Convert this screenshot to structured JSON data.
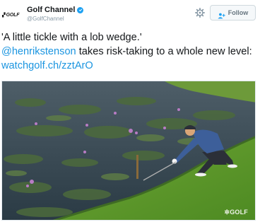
{
  "account": {
    "avatar_text": "GOLF",
    "display_name": "Golf Channel",
    "handle": "@GolfChannel",
    "verified": true
  },
  "actions": {
    "settings_icon": "gear-icon",
    "follow_label": "Follow",
    "follow_icon": "add-user-icon"
  },
  "tweet": {
    "quote": "'A little tickle with a lob wedge.'",
    "mention": "@henrikstenson",
    "text_after_mention": " takes risk-taking to a whole new level: ",
    "link": "watchgolf.ch/zztArO"
  },
  "media": {
    "watermark": "GOLF",
    "description_icon": "video-thumbnail"
  },
  "colors": {
    "link": "#1b95e0",
    "verified": "#1da1f2",
    "button_border": "#cfd9de",
    "muted": "#8899a6"
  }
}
